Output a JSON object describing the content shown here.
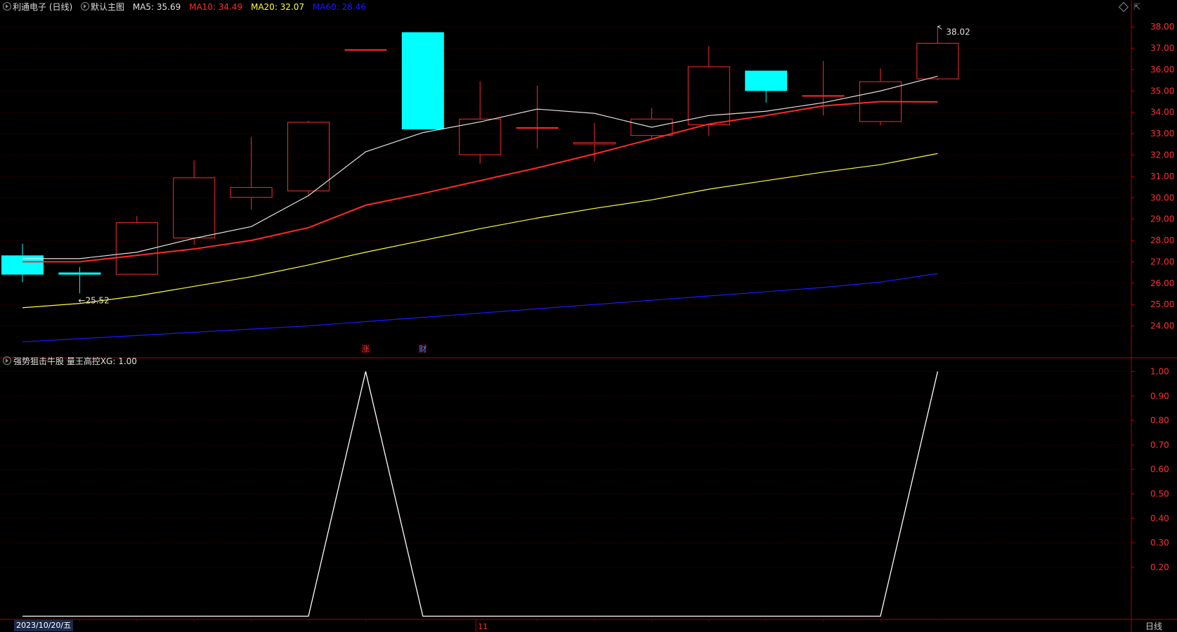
{
  "header": {
    "stock": "利通电子 (日线)",
    "main_label": "默认主图",
    "ma5": {
      "label": "MA5: 35.69",
      "color": "#e0e0e0"
    },
    "ma10": {
      "label": "MA10: 34.49",
      "color": "#ff2a2a"
    },
    "ma20": {
      "label": "MA20: 32.07",
      "color": "#ffff33"
    },
    "ma60": {
      "label": "MA60: 28.46",
      "color": "#1a1aff"
    }
  },
  "indicator_header": "强势狙击牛股  量王高控XG: 1.00",
  "period_label": "日线",
  "date_label": "2023/10/20/五",
  "month_marker": "11",
  "markers": [
    {
      "text": "涨",
      "index": 6,
      "color": "#ff3030"
    },
    {
      "text": "财",
      "index": 7,
      "color": "#4a8cff"
    }
  ],
  "colors": {
    "up": "#ff2a2a",
    "down": "#00ffff",
    "axis": "#b00000",
    "grid": "#5a0000"
  },
  "chart_data": [
    {
      "type": "candlestick",
      "title": "",
      "candles": [
        {
          "open": 27.3,
          "high": 27.85,
          "low": 26.05,
          "close": 26.4
        },
        {
          "open": 26.5,
          "high": 26.75,
          "low": 25.52,
          "close": 26.4
        },
        {
          "open": 26.4,
          "high": 29.15,
          "low": 26.4,
          "close": 28.85
        },
        {
          "open": 28.1,
          "high": 31.75,
          "low": 27.8,
          "close": 30.95
        },
        {
          "open": 30.0,
          "high": 32.85,
          "low": 29.45,
          "close": 30.5
        },
        {
          "open": 30.3,
          "high": 33.6,
          "low": 30.15,
          "close": 33.55
        },
        {
          "open": 36.95,
          "high": 36.95,
          "low": 36.95,
          "close": 36.95
        },
        {
          "open": 37.75,
          "high": 37.75,
          "low": 33.2,
          "close": 33.2
        },
        {
          "open": 32.0,
          "high": 35.45,
          "low": 31.6,
          "close": 33.7
        },
        {
          "open": 33.3,
          "high": 35.25,
          "low": 32.3,
          "close": 33.3
        },
        {
          "open": 32.5,
          "high": 33.5,
          "low": 31.7,
          "close": 32.6
        },
        {
          "open": 32.9,
          "high": 34.2,
          "low": 32.8,
          "close": 33.7
        },
        {
          "open": 33.4,
          "high": 37.1,
          "low": 32.9,
          "close": 36.15
        },
        {
          "open": 35.95,
          "high": 35.95,
          "low": 34.45,
          "close": 35.0
        },
        {
          "open": 34.8,
          "high": 36.4,
          "low": 33.85,
          "close": 34.8
        },
        {
          "open": 33.55,
          "high": 36.05,
          "low": 33.4,
          "close": 35.45
        },
        {
          "open": 35.55,
          "high": 38.02,
          "low": 35.5,
          "close": 37.25
        }
      ],
      "ma": [
        {
          "name": "MA5",
          "color": "#e0e0e0",
          "values": [
            27.15,
            27.15,
            27.45,
            28.1,
            28.65,
            30.1,
            32.15,
            33.05,
            33.55,
            34.15,
            33.95,
            33.3,
            33.85,
            34.05,
            34.45,
            35.0,
            35.69
          ]
        },
        {
          "name": "MA10",
          "color": "#ff2a2a",
          "values": [
            27.0,
            27.0,
            27.3,
            27.6,
            28.0,
            28.6,
            29.65,
            30.2,
            30.8,
            31.4,
            32.05,
            32.75,
            33.45,
            33.85,
            34.3,
            34.5,
            34.49
          ]
        },
        {
          "name": "MA20",
          "color": "#ffff33",
          "values": [
            24.85,
            25.05,
            25.4,
            25.85,
            26.3,
            26.85,
            27.45,
            28.0,
            28.55,
            29.05,
            29.5,
            29.9,
            30.4,
            30.8,
            31.2,
            31.55,
            32.07
          ]
        },
        {
          "name": "MA60",
          "color": "#1a1aff",
          "values": [
            23.25,
            23.4,
            23.55,
            23.7,
            23.85,
            24.0,
            24.2,
            24.4,
            24.6,
            24.8,
            25.0,
            25.2,
            25.4,
            25.6,
            25.8,
            26.05,
            26.45
          ]
        }
      ],
      "price_axis_ticks": [
        "38.00",
        "37.00",
        "36.00",
        "35.00",
        "34.00",
        "33.00",
        "32.00",
        "31.00",
        "30.00",
        "29.00",
        "28.00",
        "27.00",
        "26.00",
        "25.00",
        "24.00"
      ],
      "ylim": [
        22.8,
        38.6
      ],
      "annotations": [
        {
          "index": 1,
          "text": "←25.52"
        },
        {
          "index": 16,
          "text": "38.02"
        }
      ]
    },
    {
      "type": "line",
      "title": "",
      "series": [
        {
          "name": "量王高控XG",
          "color": "#ffffff",
          "values": [
            0,
            0,
            0,
            0,
            0,
            0,
            1,
            0,
            0,
            0,
            0,
            0,
            0,
            0,
            0,
            0,
            1
          ]
        }
      ],
      "axis_ticks": [
        "1.00",
        "0.90",
        "0.80",
        "0.70",
        "0.60",
        "0.50",
        "0.40",
        "0.30",
        "0.20"
      ],
      "ylim": [
        -0.01,
        1.03
      ]
    }
  ]
}
